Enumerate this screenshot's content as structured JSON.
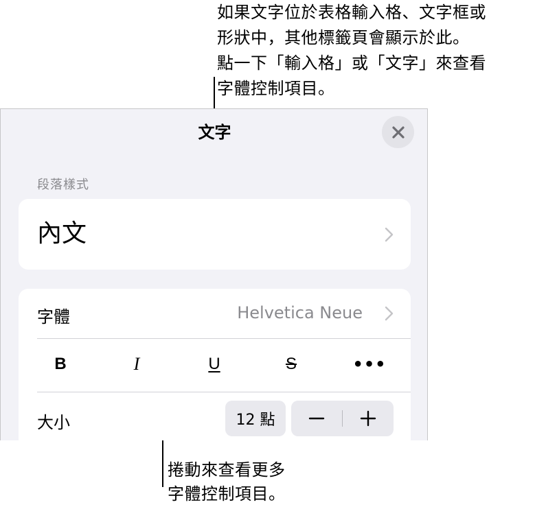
{
  "callouts": {
    "top": [
      "如果文字位於表格輸入格、文字框或",
      "形狀中，其他標籤頁會顯示於此。",
      "點一下「輸入格」或「文字」來查看",
      "字體控制項目。"
    ],
    "bottom": [
      "捲動來查看更多",
      "字體控制項目。"
    ]
  },
  "panel": {
    "title": "文字",
    "close_icon": "close-icon"
  },
  "paragraph_style": {
    "section_label": "段落樣式",
    "value": "內文"
  },
  "font": {
    "label": "字體",
    "value": "Helvetica Neue"
  },
  "format_buttons": {
    "bold": "B",
    "italic": "I",
    "underline": "U",
    "strikethrough": "S",
    "more": "•••"
  },
  "size": {
    "label": "大小",
    "value": "12 點",
    "decrease_icon": "minus-icon",
    "increase_icon": "plus-icon"
  },
  "colors": {
    "panel_bg": "#f2f2f7",
    "card_bg": "#ffffff",
    "secondary_text": "#8a8a8e",
    "control_bg": "#e9e9ee"
  }
}
